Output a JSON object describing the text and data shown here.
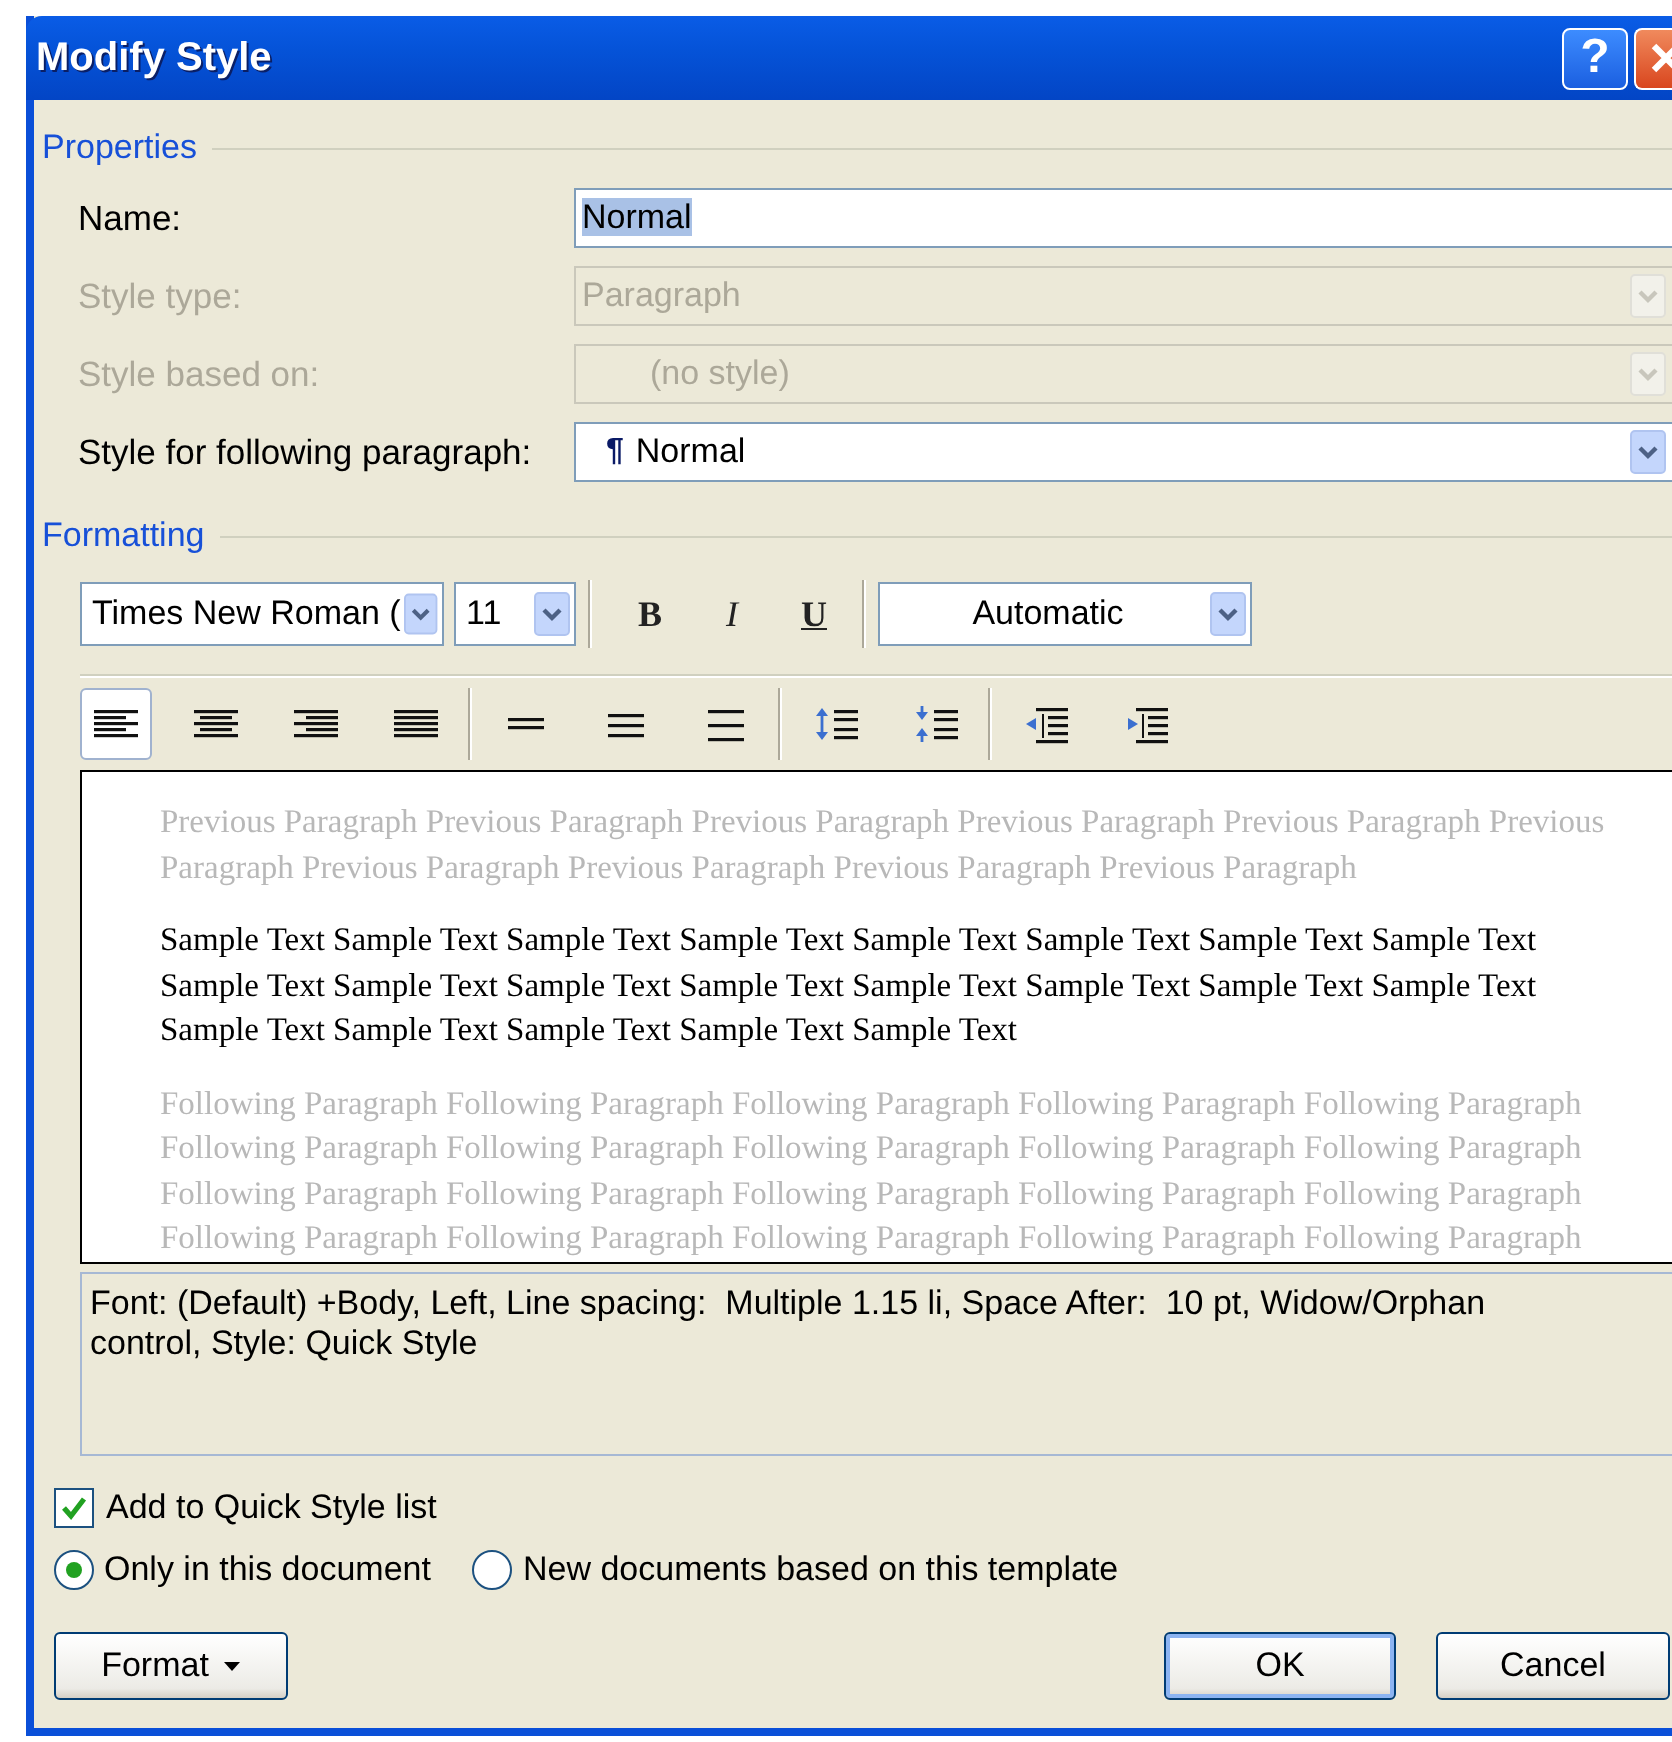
{
  "window": {
    "title": "Modify Style",
    "help_button": "?"
  },
  "properties": {
    "legend": "Properties",
    "fields": [
      {
        "label": "Name:",
        "kind": "text",
        "value": "Normal",
        "value_selected": true,
        "disabled": false
      },
      {
        "label": "Style type:",
        "kind": "combo",
        "value": "Paragraph",
        "disabled": true
      },
      {
        "label": "Style based on:",
        "kind": "combo",
        "value": "(no style)",
        "indented": true,
        "disabled": true
      },
      {
        "label": "Style for following paragraph:",
        "kind": "combo",
        "marker": "¶",
        "value": "Normal",
        "disabled": false
      }
    ]
  },
  "formatting": {
    "legend": "Formatting",
    "font": "Times New Roman (",
    "size": "11",
    "style_buttons": [
      {
        "label": "B",
        "kind": "bold"
      },
      {
        "label": "I",
        "kind": "italic"
      },
      {
        "label": "U",
        "kind": "underline"
      }
    ],
    "color_label": "Automatic",
    "paragraph_button_groups": [
      [
        {
          "kind": "align-left",
          "selected": true
        },
        {
          "kind": "align-center",
          "selected": false
        },
        {
          "kind": "align-right",
          "selected": false
        },
        {
          "kind": "justify",
          "selected": false
        }
      ],
      [
        {
          "kind": "single-spacing",
          "selected": false
        },
        {
          "kind": "one-half-spacing",
          "selected": false
        },
        {
          "kind": "double-spacing",
          "selected": false
        }
      ],
      [
        {
          "kind": "increase-spacing",
          "selected": false
        },
        {
          "kind": "decrease-spacing",
          "selected": false
        }
      ],
      [
        {
          "kind": "decrease-indent",
          "selected": false
        },
        {
          "kind": "increase-indent",
          "selected": false
        }
      ]
    ]
  },
  "preview": {
    "previous_lines": [
      "Previous Paragraph Previous Paragraph Previous Paragraph Previous Paragraph Previous Paragraph Previous",
      "Paragraph Previous Paragraph Previous Paragraph Previous Paragraph Previous Paragraph"
    ],
    "sample_lines": [
      "Sample Text Sample Text Sample Text Sample Text Sample Text Sample Text Sample Text Sample Text",
      "Sample Text Sample Text Sample Text Sample Text Sample Text Sample Text Sample Text Sample Text",
      "Sample Text Sample Text Sample Text Sample Text Sample Text"
    ],
    "following_lines": [
      "Following Paragraph Following Paragraph Following Paragraph Following Paragraph Following Paragraph",
      "Following Paragraph Following Paragraph Following Paragraph Following Paragraph Following Paragraph",
      "Following Paragraph Following Paragraph Following Paragraph Following Paragraph Following Paragraph",
      "Following Paragraph Following Paragraph Following Paragraph Following Paragraph Following Paragraph"
    ]
  },
  "description": "Font: (Default) +Body, Left, Line spacing:  Multiple 1.15 li, Space After:  10 pt, Widow/Orphan control, Style: Quick Style",
  "quick_style": {
    "label": "Add to Quick Style list",
    "checked": true
  },
  "scope": [
    {
      "label": "Only in this document",
      "selected": true
    },
    {
      "label": "New documents based on this template",
      "selected": false
    }
  ],
  "buttons": {
    "format": "Format",
    "ok": "OK",
    "cancel": "Cancel"
  }
}
